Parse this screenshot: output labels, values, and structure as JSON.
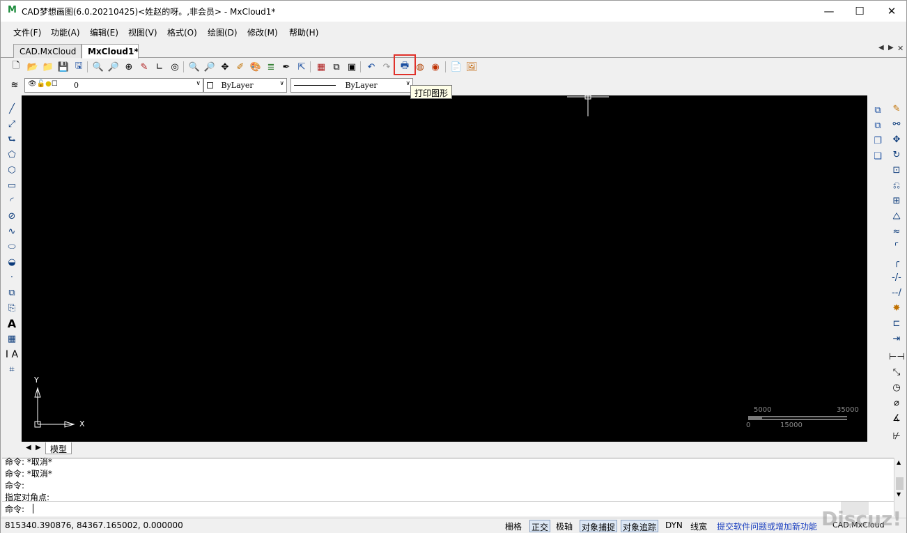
{
  "window": {
    "title": "CAD梦想画图(6.0.20210425)<姓赵的呀。,非会员> - MxCloud1*",
    "minimize": "—",
    "maximize": "☐",
    "close": "✕"
  },
  "menu": [
    "文件(F)",
    "功能(A)",
    "编辑(E)",
    "视图(V)",
    "格式(O)",
    "绘图(D)",
    "修改(M)",
    "帮助(H)"
  ],
  "tabs": [
    {
      "label": "CAD.MxCloud",
      "active": false
    },
    {
      "label": "MxCloud1*",
      "active": true
    }
  ],
  "properties": {
    "layer_value": "0",
    "color_value": "ByLayer",
    "linetype_value": "ByLayer"
  },
  "tooltip": "打印图形",
  "canvas": {
    "axis_y": "Y",
    "axis_x": "X",
    "scale_labels": {
      "a": "5000",
      "b": "35000",
      "c": "0",
      "d": "15000"
    }
  },
  "model_tab": "模型",
  "command": {
    "lines": [
      "命令:  *取消*",
      "命令:  *取消*",
      "命令:",
      " 指定对角点:"
    ],
    "prompt": "命令:"
  },
  "status": {
    "coords": "815340.390876,  84367.165002,  0.000000",
    "toggles": [
      {
        "label": "栅格",
        "on": false
      },
      {
        "label": "正交",
        "on": true
      },
      {
        "label": "极轴",
        "on": false
      },
      {
        "label": "对象捕捉",
        "on": true
      },
      {
        "label": "对象追踪",
        "on": true
      },
      {
        "label": "DYN",
        "on": false
      },
      {
        "label": "线宽",
        "on": false
      }
    ],
    "feedback_link": "提交软件问题或增加新功能",
    "brand": "CAD.MxCloud",
    "watermark": "Discuz!"
  },
  "colors": {
    "accent_highlight": "#e0312a",
    "canvas_bg": "#000000",
    "link": "#1a3fbf"
  }
}
